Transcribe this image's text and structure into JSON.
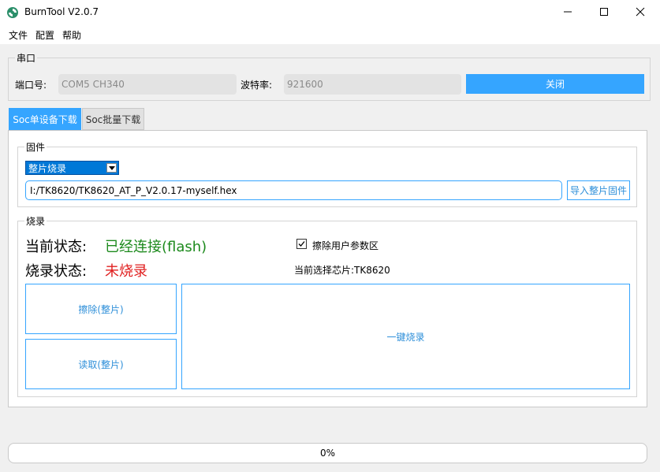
{
  "window": {
    "title": "BurnTool V2.0.7",
    "icon": "burntool-logo-icon",
    "controls": [
      "minimize-icon",
      "maximize-icon",
      "close-icon"
    ]
  },
  "menu": [
    "文件",
    "配置",
    "帮助"
  ],
  "serial": {
    "group_title": "串口",
    "port_label": "端口号:",
    "port_value": "COM5  CH340",
    "baud_label": "波特率:",
    "baud_value": "921600",
    "close_label": "关闭"
  },
  "tabs": [
    {
      "label": "Soc单设备下载",
      "active": true
    },
    {
      "label": "Soc批量下载",
      "active": false
    }
  ],
  "firmware": {
    "group_title": "固件",
    "mode": "整片烧录",
    "path": "I:/TK8620/TK8620_AT_P_V2.0.17-myself.hex",
    "import_label": "导入整片固件"
  },
  "burn": {
    "group_title": "烧录",
    "current_status_label": "当前状态:",
    "current_status_value": "已经连接(flash)",
    "burn_status_label": "烧录状态:",
    "burn_status_value": "未烧录",
    "erase_user_params_label": "擦除用户参数区",
    "erase_user_params_checked": true,
    "selected_chip": "当前选择芯片:TK8620",
    "erase_button": "擦除(整片)",
    "read_button": "读取(整片)",
    "oneclick_button": "一键烧录"
  },
  "progress": {
    "value": 0,
    "text": "0%"
  },
  "colors": {
    "accent": "#35a5ff",
    "status_ok": "#1d8a1d",
    "status_bad": "#e01e1e"
  }
}
